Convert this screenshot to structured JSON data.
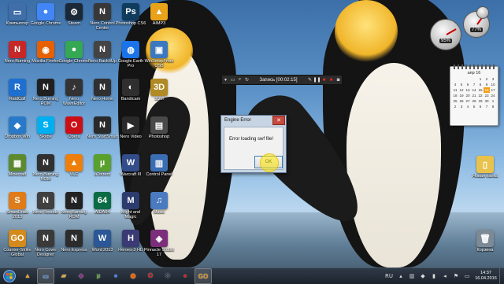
{
  "desktop_icons": [
    {
      "label": "Компьютер",
      "glyph": "▭",
      "color": "#3f6ea8"
    },
    {
      "label": "Nero Burning",
      "glyph": "N",
      "color": "#c62828"
    },
    {
      "label": "RaidCall",
      "glyph": "R",
      "color": "#1e6fd0"
    },
    {
      "label": "Dropbox Win",
      "glyph": "◆",
      "color": "#2979c9"
    },
    {
      "label": "Minecraft",
      "glyph": "▦",
      "color": "#5d8a2f"
    },
    {
      "label": "SmartDraw 2013",
      "glyph": "S",
      "color": "#e07b1a"
    },
    {
      "label": "Counter-Strike Global Offensive",
      "glyph": "GO",
      "color": "#d48a1c"
    },
    {
      "label": "Google Chrome",
      "glyph": "●",
      "color": "#4285f4"
    },
    {
      "label": "Mozilla Firefox",
      "glyph": "◉",
      "color": "#e66000"
    },
    {
      "label": "Nero Burning ROM",
      "glyph": "N",
      "color": "#202020"
    },
    {
      "label": "Skype",
      "glyph": "S",
      "color": "#00aff0"
    },
    {
      "label": "Nero Burning ROM",
      "glyph": "N",
      "color": "#303030"
    },
    {
      "label": "Nero Recode",
      "glyph": "N",
      "color": "#404040"
    },
    {
      "label": "Nero Cover Designer",
      "glyph": "N",
      "color": "#3a3a3a"
    },
    {
      "label": "Steam",
      "glyph": "⚙",
      "color": "#1b2838"
    },
    {
      "label": "Google Chrome",
      "glyph": "●",
      "color": "#34a853"
    },
    {
      "label": "Nero WaveEditor",
      "glyph": "♪",
      "color": "#333"
    },
    {
      "label": "Opera",
      "glyph": "O",
      "color": "#cc0f16"
    },
    {
      "label": "VLC",
      "glyph": "▲",
      "color": "#ef7f0a"
    },
    {
      "label": "Nero Burning ROM",
      "glyph": "N",
      "color": "#222"
    },
    {
      "label": "Nero Express",
      "glyph": "N",
      "color": "#2c2c2c"
    },
    {
      "label": "Nero Control Center",
      "glyph": "N",
      "color": "#383838"
    },
    {
      "label": "Nero BackItUp",
      "glyph": "N",
      "color": "#444"
    },
    {
      "label": "Nero Home",
      "glyph": "N",
      "color": "#303030"
    },
    {
      "label": "Nero StartSmart",
      "glyph": "N",
      "color": "#2a2a2a"
    },
    {
      "label": "uTorrent",
      "glyph": "µ",
      "color": "#5aa02c"
    },
    {
      "label": "AIDA64",
      "glyph": "64",
      "color": "#0a6b44"
    },
    {
      "label": "Word 2013",
      "glyph": "W",
      "color": "#2b5797"
    },
    {
      "label": "Photoshop CS6",
      "glyph": "Ps",
      "color": "#0f3b5c"
    },
    {
      "label": "Google Earth Pro",
      "glyph": "◍",
      "color": "#1a73e8"
    },
    {
      "label": "Bandicam",
      "glyph": "◐",
      "color": "#2f2f2f"
    },
    {
      "label": "Nero Video",
      "glyph": "▶",
      "color": "#2a2a2a"
    },
    {
      "label": "Warcraft III",
      "glyph": "W",
      "color": "#334d8a"
    },
    {
      "label": "Might and Magic",
      "glyph": "M",
      "color": "#2d3c6e"
    },
    {
      "label": "Heroes 3 HD",
      "glyph": "H",
      "color": "#3a3a74"
    },
    {
      "label": "AIMP3",
      "glyph": "▲",
      "color": "#e9a31b"
    },
    {
      "label": "WinSetupFromUSB",
      "glyph": "▣",
      "color": "#3c78c0"
    },
    {
      "label": "3DM",
      "glyph": "3D",
      "color": "#b08a24"
    },
    {
      "label": "Photoshop",
      "glyph": "▤",
      "color": "#4a4a4a"
    },
    {
      "label": "Control Panel",
      "glyph": "▥",
      "color": "#3b6db3"
    },
    {
      "label": "Music",
      "glyph": "♫",
      "color": "#4a7abf"
    },
    {
      "label": "Pinnacle Studio 17",
      "glyph": "◈",
      "color": "#7b2f7b"
    }
  ],
  "right_icons": [
    {
      "label": "Новая папка",
      "glyph": "▯",
      "color": "#e8c24a"
    },
    {
      "label": "Корзина",
      "glyph": "🗑",
      "color": "#7d8a95"
    }
  ],
  "recorder": {
    "title": "Запись [00:02:15]"
  },
  "dialog": {
    "title": "Engine Error",
    "message": "Error loading swf file!",
    "ok_label": "OK",
    "close_glyph": "✕"
  },
  "gadgets": {
    "cpu_value": "95%",
    "mem_value": "77%",
    "calendar_month": "апр 16",
    "calendar_days": [
      "",
      "",
      "",
      "",
      "1",
      "2",
      "3",
      "4",
      "5",
      "6",
      "7",
      "8",
      "9",
      "10",
      "11",
      "12",
      "13",
      "14",
      "15",
      "16",
      "17",
      "18",
      "19",
      "20",
      "21",
      "22",
      "23",
      "24",
      "25",
      "26",
      "27",
      "28",
      "29",
      "30",
      "1",
      "2",
      "3",
      "4",
      "5",
      "6",
      "7",
      "8"
    ],
    "today": "16"
  },
  "taskbar": {
    "items": [
      {
        "glyph": "▲",
        "color": "#f0a020"
      },
      {
        "glyph": "▭",
        "color": "#3f7fc8"
      },
      {
        "glyph": "▰",
        "color": "#d8a840"
      },
      {
        "glyph": "◈",
        "color": "#7b2f7b"
      },
      {
        "glyph": "µ",
        "color": "#5aa02c"
      },
      {
        "glyph": "●",
        "color": "#4285f4"
      },
      {
        "glyph": "◉",
        "color": "#e66000"
      },
      {
        "glyph": "O",
        "color": "#cc0f16"
      },
      {
        "glyph": "⚙",
        "color": "#1b2838"
      },
      {
        "glyph": "●",
        "color": "#d62020"
      },
      {
        "glyph": "GO",
        "color": "#d48a1c"
      }
    ],
    "language": "RU",
    "time": "14:37",
    "date": "16.04.2016"
  }
}
